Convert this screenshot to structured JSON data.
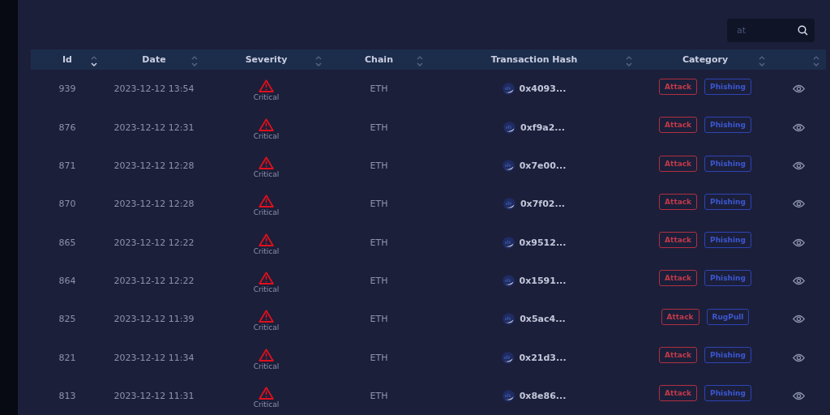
{
  "search": {
    "placeholder": "at"
  },
  "table": {
    "columns": [
      {
        "label": "Id",
        "sorted": true
      },
      {
        "label": "Date",
        "sorted": false
      },
      {
        "label": "Severity",
        "sorted": false
      },
      {
        "label": "Chain",
        "sorted": false
      },
      {
        "label": "Transaction Hash",
        "sorted": false
      },
      {
        "label": "Category",
        "sorted": false
      },
      {
        "sorted": false
      }
    ],
    "rows": [
      {
        "id": "939",
        "date": "2023-12-12 13:54",
        "severity": "Critical",
        "chain": "ETH",
        "hash": "0x4093...",
        "tags": [
          "Attack",
          "Phishing"
        ]
      },
      {
        "id": "876",
        "date": "2023-12-12 12:31",
        "severity": "Critical",
        "chain": "ETH",
        "hash": "0xf9a2...",
        "tags": [
          "Attack",
          "Phishing"
        ]
      },
      {
        "id": "871",
        "date": "2023-12-12 12:28",
        "severity": "Critical",
        "chain": "ETH",
        "hash": "0x7e00...",
        "tags": [
          "Attack",
          "Phishing"
        ]
      },
      {
        "id": "870",
        "date": "2023-12-12 12:28",
        "severity": "Critical",
        "chain": "ETH",
        "hash": "0x7f02...",
        "tags": [
          "Attack",
          "Phishing"
        ]
      },
      {
        "id": "865",
        "date": "2023-12-12 12:22",
        "severity": "Critical",
        "chain": "ETH",
        "hash": "0x9512...",
        "tags": [
          "Attack",
          "Phishing"
        ]
      },
      {
        "id": "864",
        "date": "2023-12-12 12:22",
        "severity": "Critical",
        "chain": "ETH",
        "hash": "0x1591...",
        "tags": [
          "Attack",
          "Phishing"
        ]
      },
      {
        "id": "825",
        "date": "2023-12-12 11:39",
        "severity": "Critical",
        "chain": "ETH",
        "hash": "0x5ac4...",
        "tags": [
          "Attack",
          "RugPull"
        ]
      },
      {
        "id": "821",
        "date": "2023-12-12 11:34",
        "severity": "Critical",
        "chain": "ETH",
        "hash": "0x21d3...",
        "tags": [
          "Attack",
          "Phishing"
        ]
      },
      {
        "id": "813",
        "date": "2023-12-12 11:31",
        "severity": "Critical",
        "chain": "ETH",
        "hash": "0x8e86...",
        "tags": [
          "Attack",
          "Phishing"
        ]
      }
    ]
  }
}
